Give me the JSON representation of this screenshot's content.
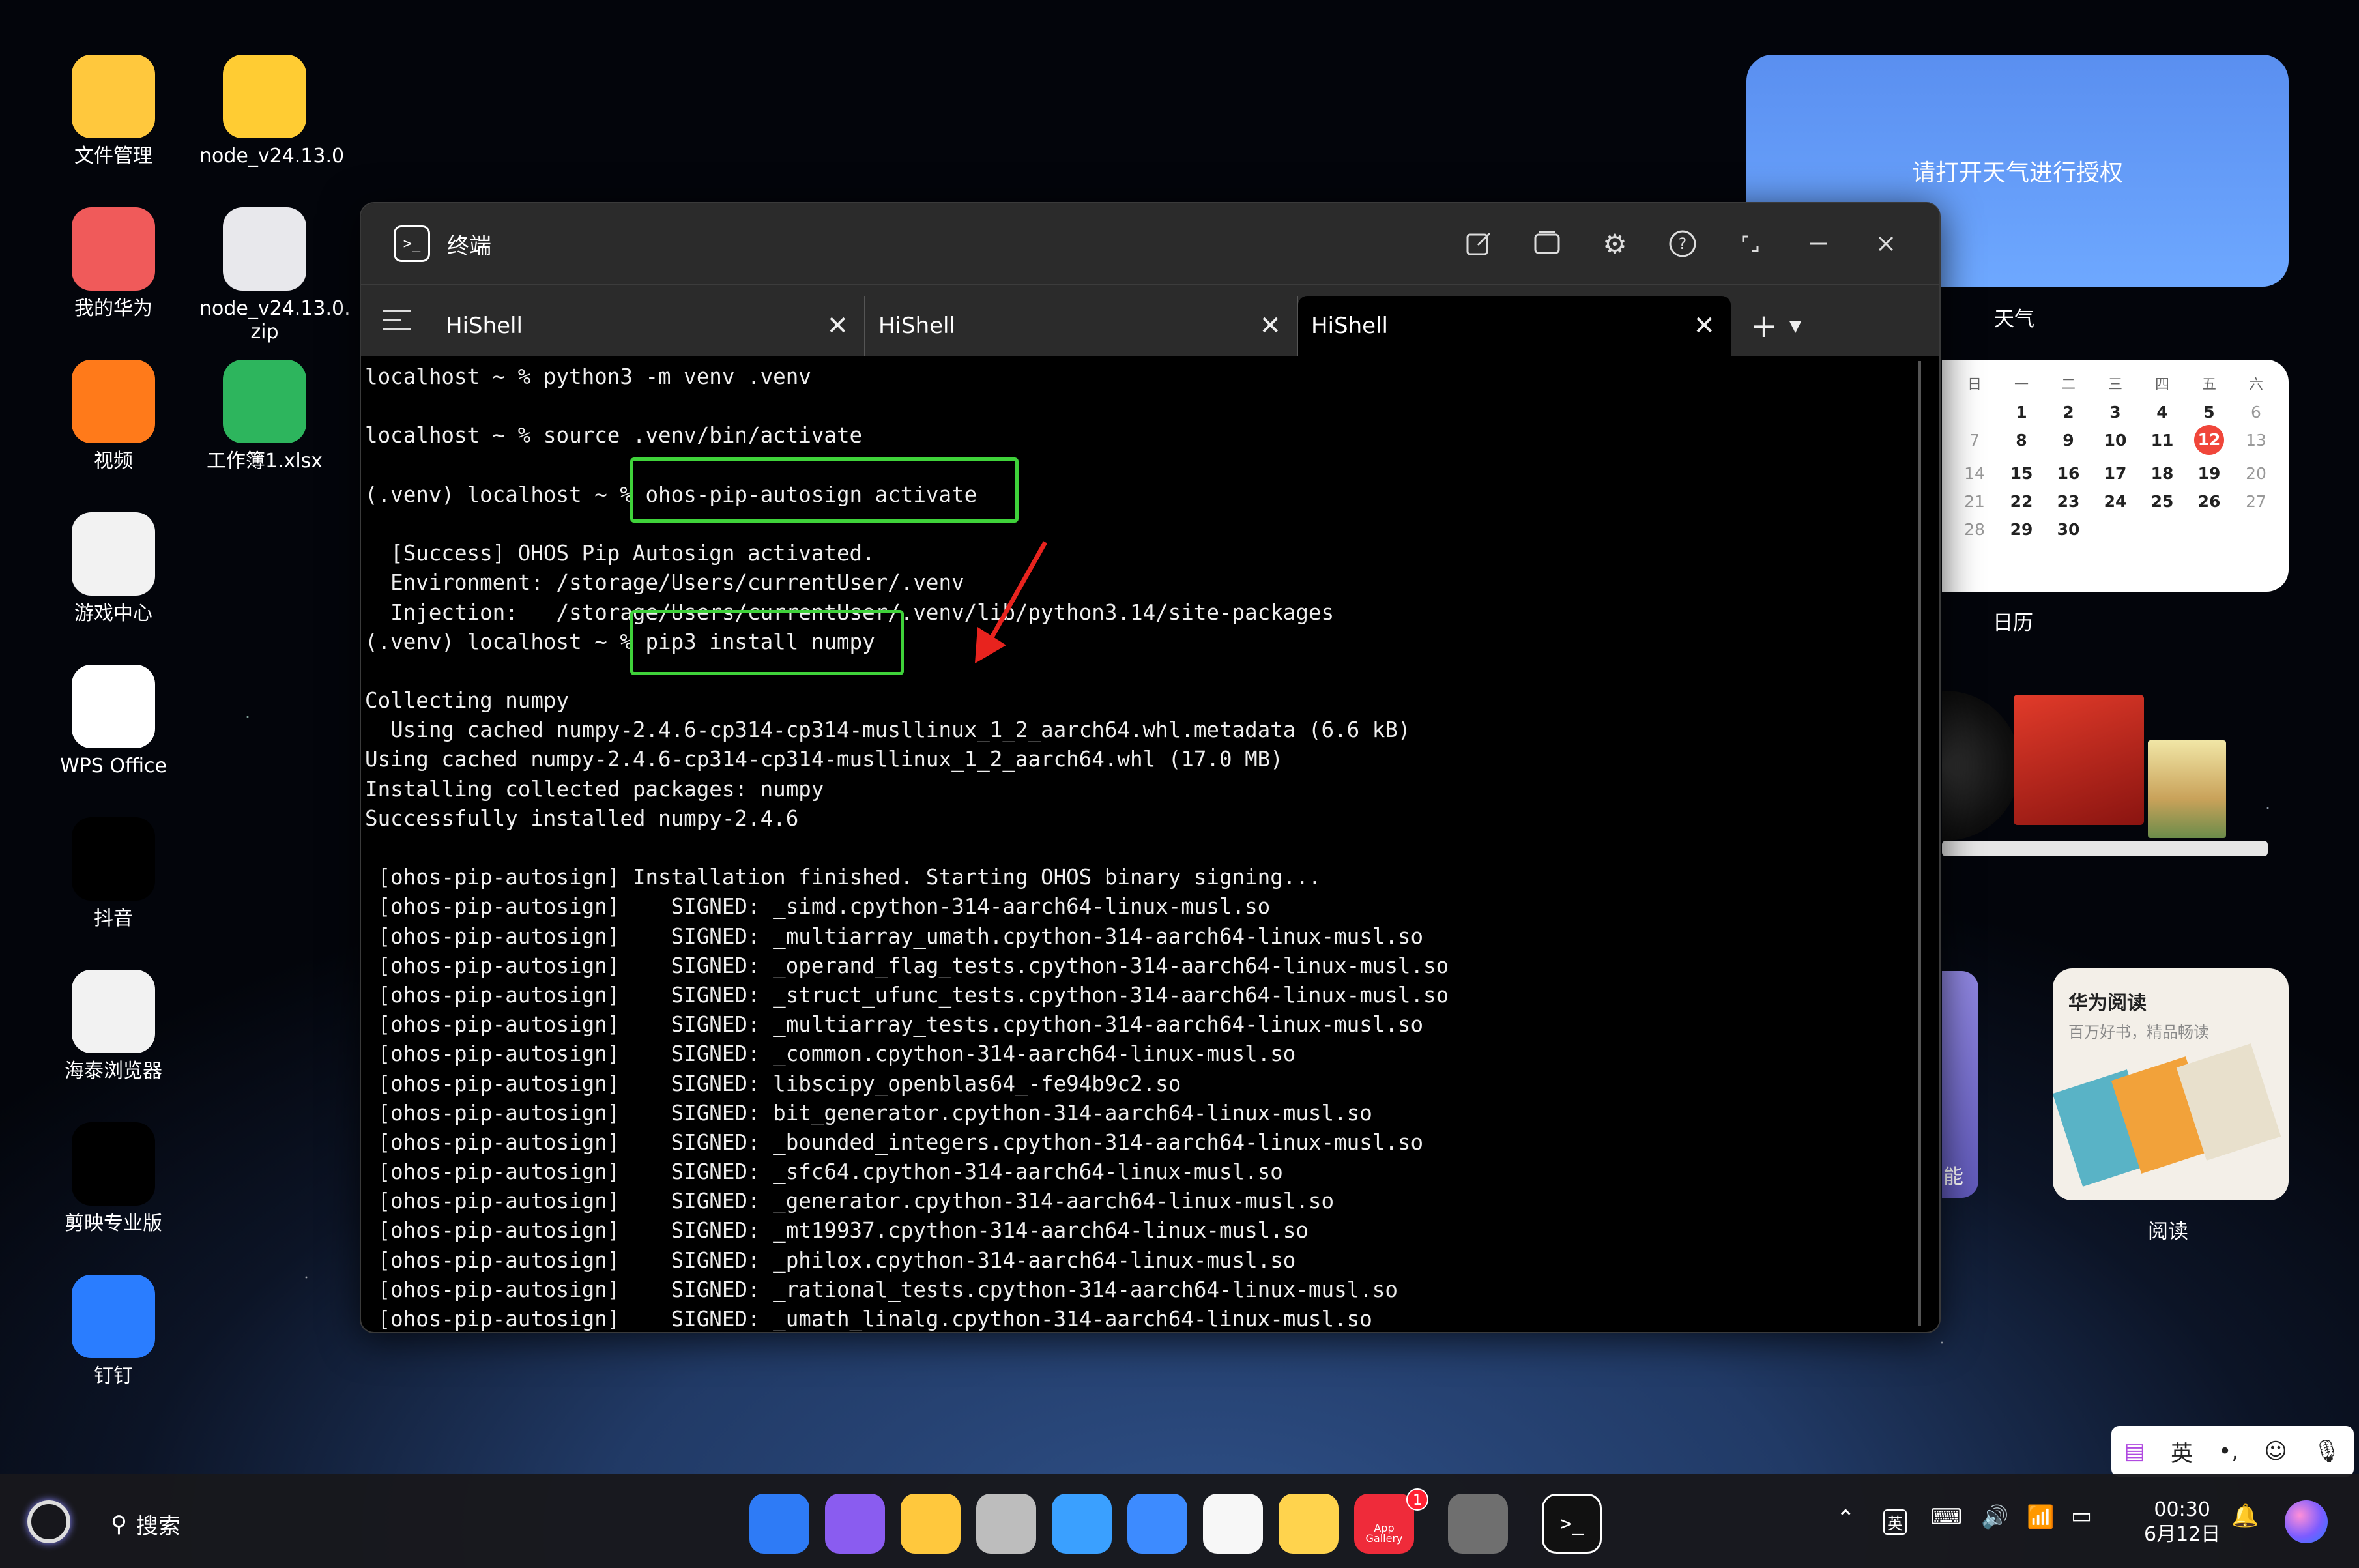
{
  "desktop": {
    "icons_col1": [
      {
        "label": "文件管理",
        "icon": "file-manager-icon",
        "color": "#ffc83d"
      },
      {
        "label": "我的华为",
        "icon": "my-huawei-icon",
        "color": "#f05a5a"
      },
      {
        "label": "视频",
        "icon": "video-icon",
        "color": "#ff7a1a"
      },
      {
        "label": "游戏中心",
        "icon": "game-center-icon",
        "color": "#f2f2f2"
      },
      {
        "label": "WPS Office",
        "icon": "wps-icon",
        "color": "#ffffff"
      },
      {
        "label": "抖音",
        "icon": "douyin-icon",
        "color": "#000000"
      },
      {
        "label": "海泰浏览器",
        "icon": "browser-icon",
        "color": "#f2f2f2"
      },
      {
        "label": "剪映专业版",
        "icon": "capcut-icon",
        "color": "#000000"
      },
      {
        "label": "钉钉",
        "icon": "dingtalk-icon",
        "color": "#2a7dff"
      }
    ],
    "icons_col2": [
      {
        "label": "node_v24.13.0",
        "icon": "folder-icon",
        "color": "#ffcc33"
      },
      {
        "label": "node_v24.13.0.\nzip",
        "icon": "zip-icon",
        "color": "#e8e8ec"
      },
      {
        "label": "工作簿1.xlsx",
        "icon": "excel-icon",
        "color": "#2db55d"
      }
    ]
  },
  "terminal": {
    "title": "终端",
    "tabs": [
      "HiShell",
      "HiShell",
      "HiShell"
    ],
    "active_tab": 2,
    "lines": [
      "localhost ~ % python3 -m venv .venv",
      "",
      "localhost ~ % source .venv/bin/activate",
      "",
      "(.venv) localhost ~ % ohos-pip-autosign activate",
      "",
      "  [Success] OHOS Pip Autosign activated.",
      "  Environment: /storage/Users/currentUser/.venv",
      "  Injection:   /storage/Users/currentUser/.venv/lib/python3.14/site-packages",
      "(.venv) localhost ~ % pip3 install numpy",
      "",
      "Collecting numpy",
      "  Using cached numpy-2.4.6-cp314-cp314-musllinux_1_2_aarch64.whl.metadata (6.6 kB)",
      "Using cached numpy-2.4.6-cp314-cp314-musllinux_1_2_aarch64.whl (17.0 MB)",
      "Installing collected packages: numpy",
      "Successfully installed numpy-2.4.6",
      "",
      " [ohos-pip-autosign] Installation finished. Starting OHOS binary signing...",
      " [ohos-pip-autosign]    SIGNED: _simd.cpython-314-aarch64-linux-musl.so",
      " [ohos-pip-autosign]    SIGNED: _multiarray_umath.cpython-314-aarch64-linux-musl.so",
      " [ohos-pip-autosign]    SIGNED: _operand_flag_tests.cpython-314-aarch64-linux-musl.so",
      " [ohos-pip-autosign]    SIGNED: _struct_ufunc_tests.cpython-314-aarch64-linux-musl.so",
      " [ohos-pip-autosign]    SIGNED: _multiarray_tests.cpython-314-aarch64-linux-musl.so",
      " [ohos-pip-autosign]    SIGNED: _common.cpython-314-aarch64-linux-musl.so",
      " [ohos-pip-autosign]    SIGNED: libscipy_openblas64_-fe94b9c2.so",
      " [ohos-pip-autosign]    SIGNED: bit_generator.cpython-314-aarch64-linux-musl.so",
      " [ohos-pip-autosign]    SIGNED: _bounded_integers.cpython-314-aarch64-linux-musl.so",
      " [ohos-pip-autosign]    SIGNED: _sfc64.cpython-314-aarch64-linux-musl.so",
      " [ohos-pip-autosign]    SIGNED: _generator.cpython-314-aarch64-linux-musl.so",
      " [ohos-pip-autosign]    SIGNED: _mt19937.cpython-314-aarch64-linux-musl.so",
      " [ohos-pip-autosign]    SIGNED: _philox.cpython-314-aarch64-linux-musl.so",
      " [ohos-pip-autosign]    SIGNED: _rational_tests.cpython-314-aarch64-linux-musl.so",
      " [ohos-pip-autosign]    SIGNED: _umath_linalg.cpython-314-aarch64-linux-musl.so"
    ],
    "highlight_color": "#3fd23a",
    "arrow_color": "#e8231e"
  },
  "widgets": {
    "weather": {
      "message": "请打开天气进行授权",
      "label": "天气"
    },
    "calendar": {
      "label": "日历",
      "weekdays": [
        "日",
        "一",
        "二",
        "三",
        "四",
        "五",
        "六"
      ],
      "days": [
        "",
        "1",
        "2",
        "3",
        "4",
        "5",
        "6",
        "7",
        "8",
        "9",
        "10",
        "11",
        "12",
        "13",
        "14",
        "15",
        "16",
        "17",
        "18",
        "19",
        "20",
        "21",
        "22",
        "23",
        "24",
        "25",
        "26",
        "27",
        "28",
        "29",
        "30"
      ],
      "today": "12",
      "today_color": "#f0463a"
    },
    "reading": {
      "title": "华为阅读",
      "subtitle": "百万好书，精品畅读",
      "label": "阅读"
    },
    "partial_label": "能"
  },
  "ime": {
    "lang": "英",
    "punct": "•,"
  },
  "taskbar": {
    "search": "搜索",
    "time": "00:30",
    "date": "6月12日",
    "badge": "1",
    "app_gallery": "App\nGallery",
    "ime_indicator": "英",
    "dock": [
      "app-center-icon",
      "multitask-icon",
      "files-icon",
      "trash-icon",
      "browser-icon",
      "mail-icon",
      "photos-icon",
      "notes-icon",
      "app-gallery-icon",
      "settings-icon",
      "terminal-icon"
    ]
  }
}
